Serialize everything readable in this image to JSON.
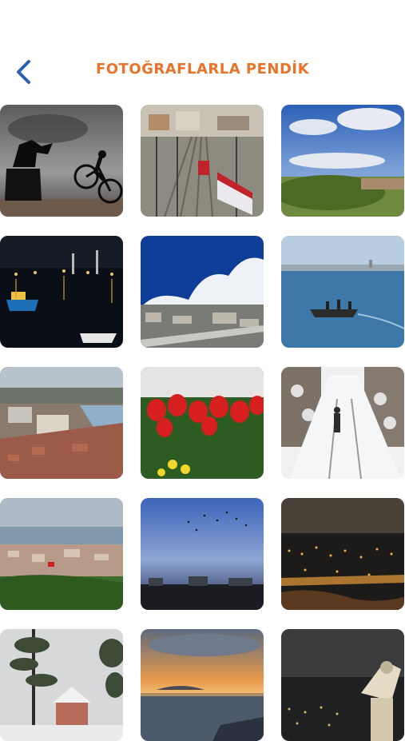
{
  "header": {
    "title": "FOTOĞRAFLARLA PENDİK",
    "back_icon": "chevron-left-icon"
  },
  "colors": {
    "accent": "#E8732A",
    "back_icon": "#2B5FB4",
    "background": "#FFFFFF"
  },
  "photos": [
    {
      "subject": "statue-and-cyclist-silhouette"
    },
    {
      "subject": "train-station"
    },
    {
      "subject": "coastal-landscape-blue-sky"
    },
    {
      "subject": "harbor-at-night"
    },
    {
      "subject": "coastal-town-clouds"
    },
    {
      "subject": "fishing-boat-sea"
    },
    {
      "subject": "aerial-city-coast"
    },
    {
      "subject": "red-tulips"
    },
    {
      "subject": "snowy-tree-path"
    },
    {
      "subject": "city-panorama-sea"
    },
    {
      "subject": "birds-at-dusk"
    },
    {
      "subject": "city-lights-night"
    },
    {
      "subject": "snowy-trees-town"
    },
    {
      "subject": "sunset-over-islands"
    },
    {
      "subject": "coin-telescope-night"
    }
  ]
}
